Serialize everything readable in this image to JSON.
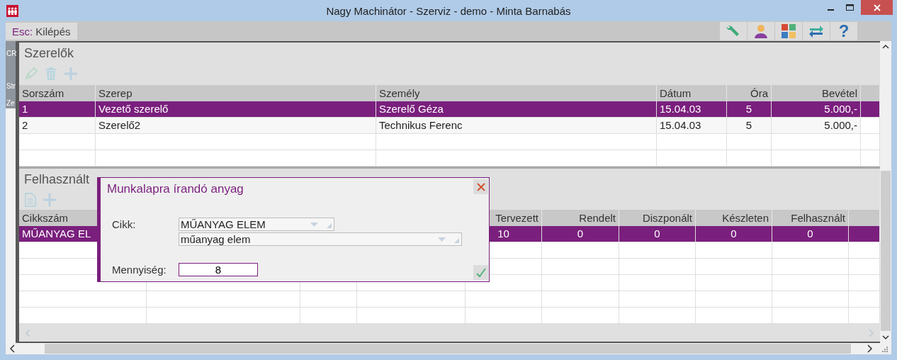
{
  "window": {
    "title": "Nagy Machinátor - Szerviz - demo - Minta Barnabás"
  },
  "toolbar": {
    "exit": {
      "key": "Esc:",
      "label": "Kilépés"
    },
    "help": "?"
  },
  "side_texts": [
    "CR",
    "Str",
    "Ze"
  ],
  "mechanics": {
    "title": "Szerelők",
    "columns": [
      "Sorszám",
      "Szerep",
      "Személy",
      "Dátum",
      "Óra",
      "Bevétel"
    ],
    "rows": [
      {
        "cells": [
          "1",
          "Vezető szerelő",
          "Szerelő Géza",
          "15.04.03",
          "5",
          "5.000,-"
        ],
        "selected": true
      },
      {
        "cells": [
          "2",
          "Szerelő2",
          "Technikus Ferenc",
          "15.04.03",
          "5",
          "5.000,-"
        ],
        "selected": false
      }
    ]
  },
  "materials": {
    "title": "Felhasznált",
    "columns": [
      "Cikkszám",
      "Tervezett",
      "Rendelt",
      "Diszponált",
      "Készleten",
      "Felhasznált"
    ],
    "rows": [
      {
        "cells": [
          "MŰANYAG EL",
          "10",
          "0",
          "0",
          "0",
          "0"
        ],
        "selected": true
      }
    ]
  },
  "dialog": {
    "title": "Munkalapra írandó anyag",
    "item_label": "Cikk:",
    "item_code": "MŰANYAG ELEM",
    "item_name": "műanyag elem",
    "quantity_label": "Mennyiség:",
    "quantity": "8"
  }
}
